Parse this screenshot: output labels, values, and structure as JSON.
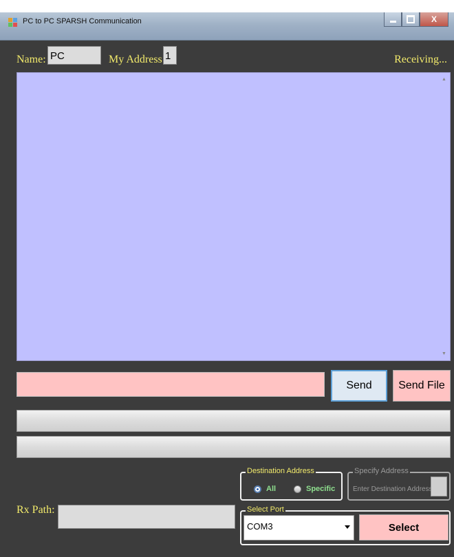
{
  "window": {
    "title": "PC to PC SPARSH Communication",
    "close_label": "X"
  },
  "header": {
    "name_label": "Name:",
    "name_value": "PC",
    "address_label": "My Address:",
    "address_value": "1",
    "status_text": "Receiving..."
  },
  "compose": {
    "message_value": "",
    "send_label": "Send",
    "send_file_label": "Send File"
  },
  "destination": {
    "legend": "Destination Address",
    "options": [
      "All",
      "Specific"
    ],
    "selected": "All"
  },
  "specify_address": {
    "legend": "Specify Address",
    "label": "Enter Destination Address :"
  },
  "port": {
    "legend": "Select Port",
    "selected_value": "COM3",
    "select_button": "Select"
  },
  "rx": {
    "label": "Rx Path:",
    "value": ""
  },
  "colors": {
    "form_background": "#3c3c3c",
    "label_yellow": "#f2ea6b",
    "message_area": "#c0c0ff",
    "pink_controls": "#ffc3c3",
    "radio_text_green": "#8fe08f"
  }
}
